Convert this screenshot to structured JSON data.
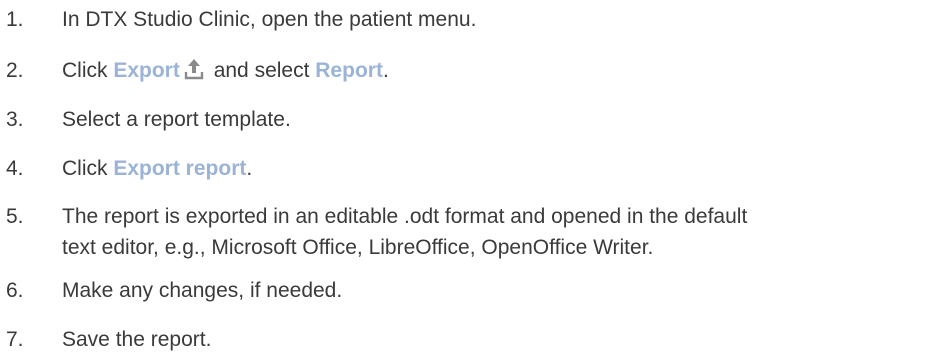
{
  "steps": [
    {
      "number": "1.",
      "text": "In DTX Studio Clinic, open the patient menu."
    },
    {
      "number": "2.",
      "before": "Click ",
      "ui1": "Export",
      "middle": " and select ",
      "ui2": "Report",
      "after": ".",
      "icon": "export-upload-icon"
    },
    {
      "number": "3.",
      "text": "Select a report template."
    },
    {
      "number": "4.",
      "before": "Click ",
      "ui1": "Export report",
      "after": "."
    },
    {
      "number": "5.",
      "line1": "The report is exported in an editable .odt format and opened in the default",
      "line2": "text editor, e.g., Microsoft Office, LibreOffice, OpenOffice Writer."
    },
    {
      "number": "6.",
      "text": "Make any changes, if needed."
    },
    {
      "number": "7.",
      "text": "Save the report."
    }
  ],
  "colors": {
    "text": "#3a3a3a",
    "ui_label": "#9bb3d6",
    "icon": "#8a8a8a"
  }
}
